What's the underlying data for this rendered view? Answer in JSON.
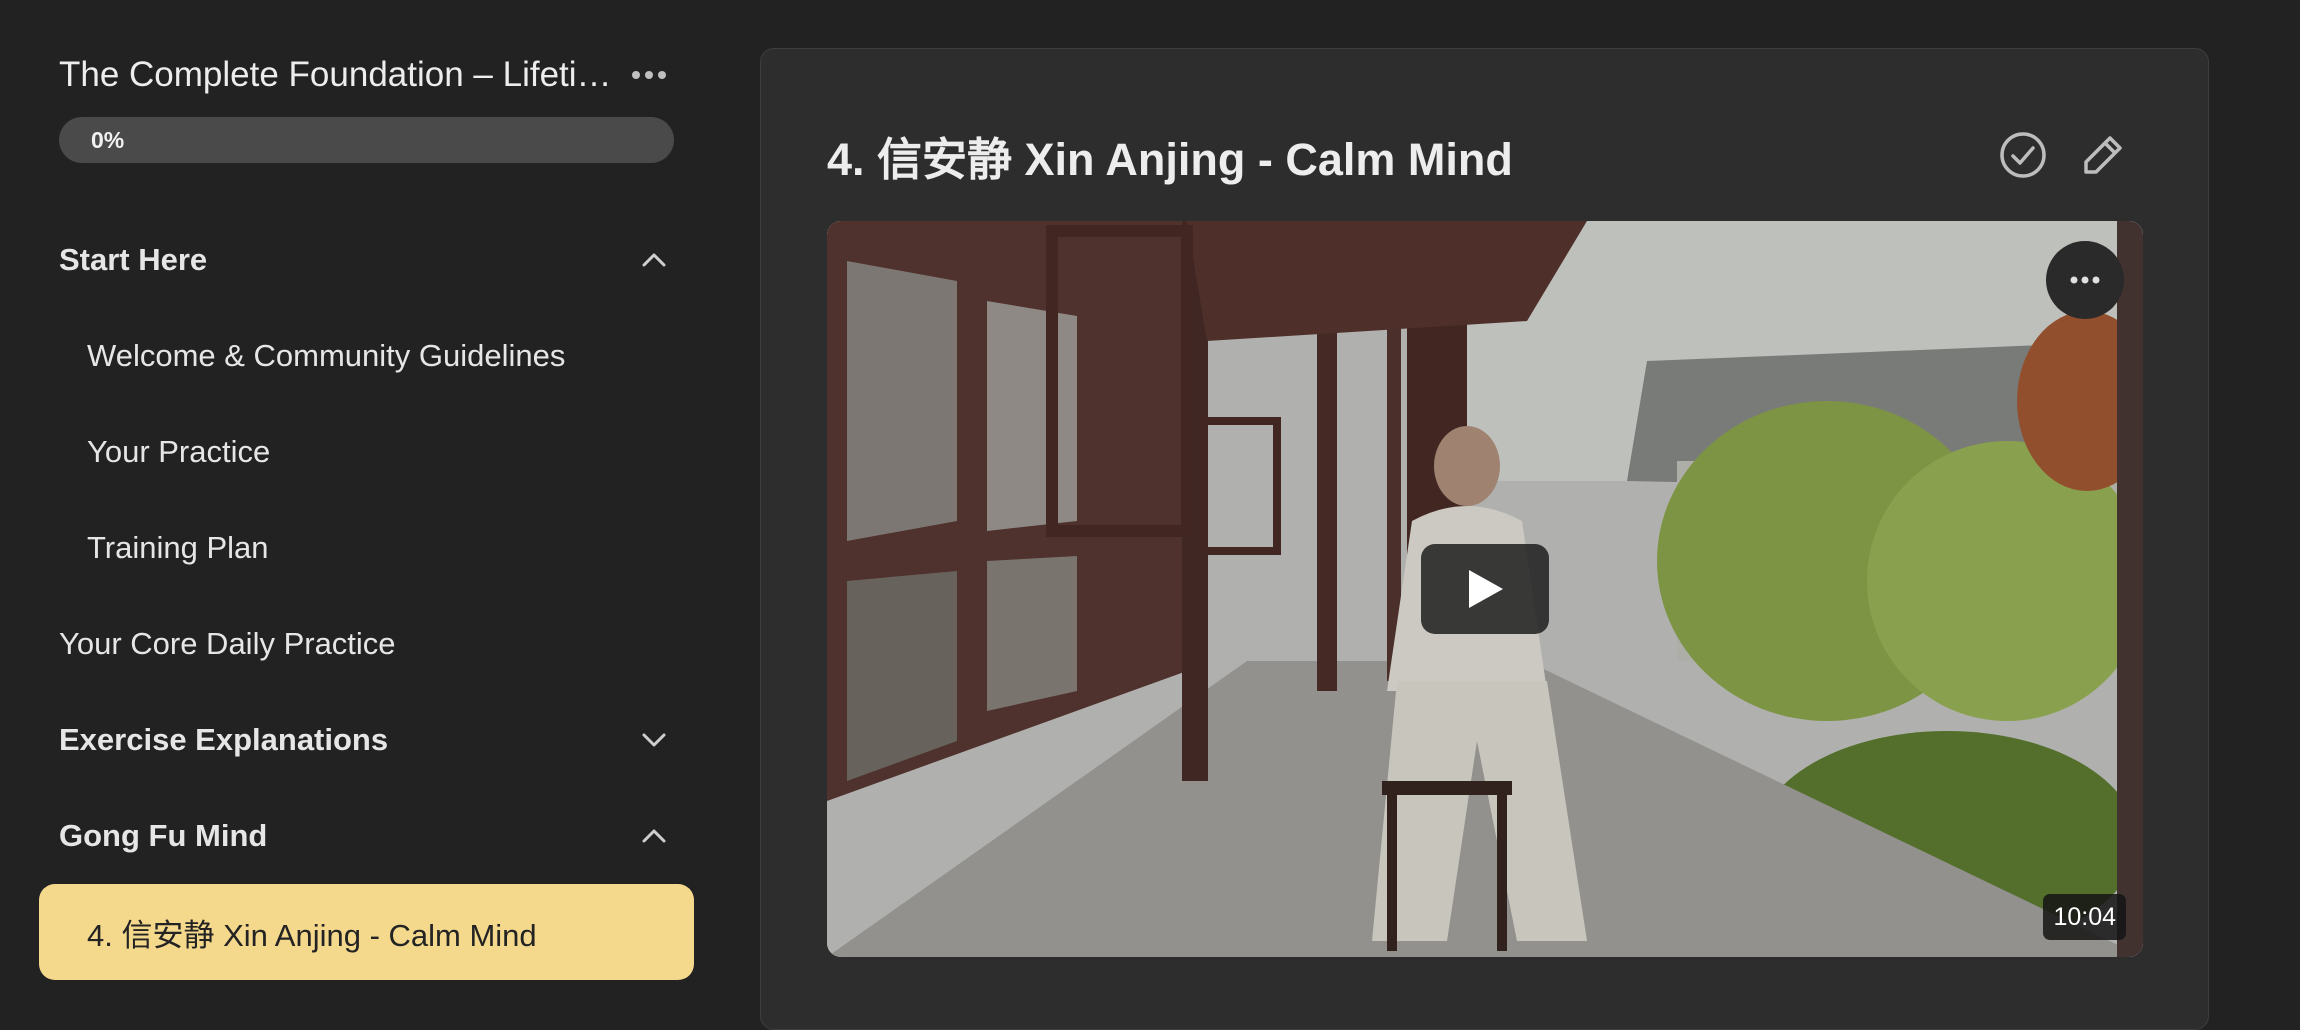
{
  "sidebar": {
    "course_title": "The Complete Foundation – Lifetime Access",
    "progress_percent": 0,
    "progress_label": "0%",
    "items": [
      {
        "label": "Start Here",
        "type": "section",
        "expanded": true
      },
      {
        "label": "Welcome & Community Guidelines",
        "type": "lesson"
      },
      {
        "label": "Your Practice",
        "type": "lesson"
      },
      {
        "label": "Training Plan",
        "type": "lesson"
      },
      {
        "label": "Your Core Daily Practice",
        "type": "page"
      },
      {
        "label": "Exercise Explanations",
        "type": "section",
        "expanded": false
      },
      {
        "label": "Gong Fu Mind",
        "type": "section",
        "expanded": true
      },
      {
        "label": "4. 信安静 Xin Anjing - Calm Mind",
        "type": "lesson",
        "active": true
      }
    ]
  },
  "lesson": {
    "title": "4. 信安静 Xin Anjing - Calm Mind",
    "video_duration": "10:04"
  },
  "icons": {
    "course_menu": "more-horizontal-icon",
    "complete": "check-circle-icon",
    "edit": "pencil-icon",
    "video_menu": "more-horizontal-icon",
    "play": "play-icon",
    "expand_open": "chevron-up-icon",
    "expand_closed": "chevron-down-icon"
  },
  "colors": {
    "background": "#222222",
    "panel": "#2d2d2d",
    "active_item": "#f4d88c",
    "progress_track": "#4a4a4a"
  }
}
